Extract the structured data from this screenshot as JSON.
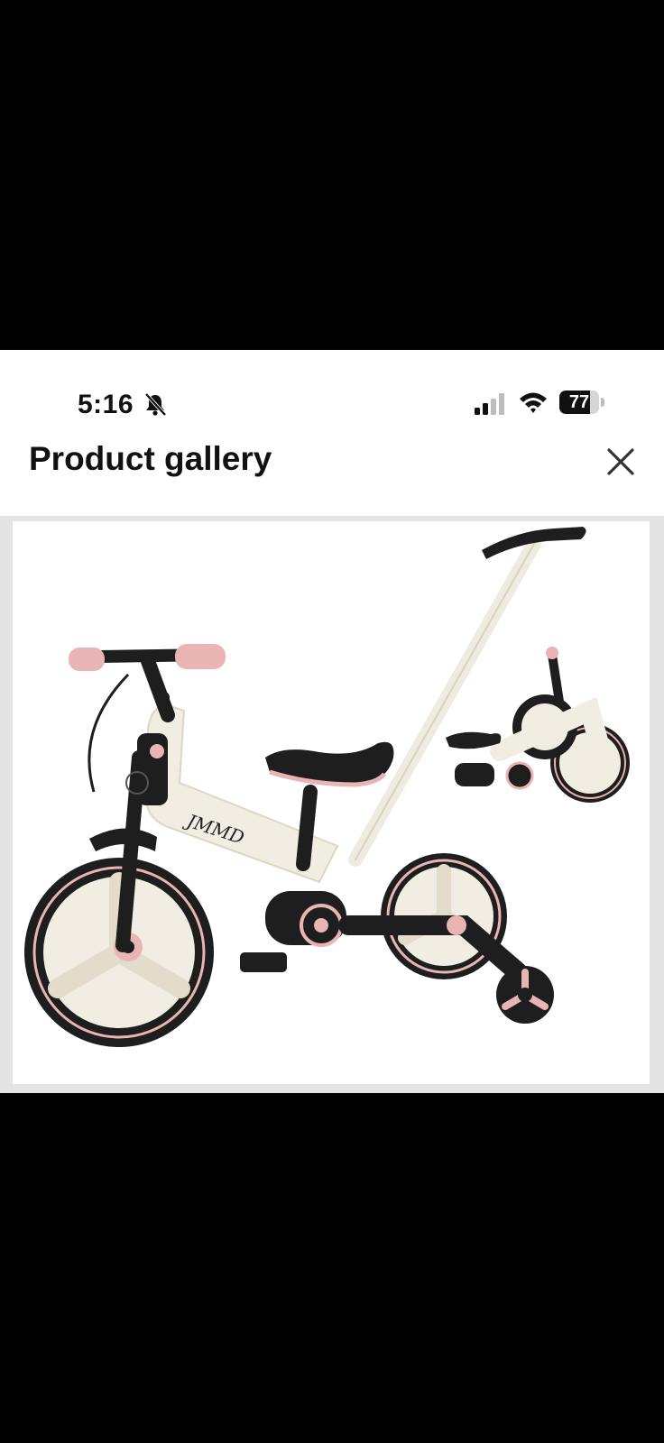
{
  "status_bar": {
    "time": "5:16",
    "battery_level": "77",
    "battery_fraction": 0.77,
    "icons": [
      "bell-slash-icon",
      "cellular-signal-icon",
      "wifi-icon",
      "battery-icon"
    ]
  },
  "header": {
    "title": "Product gallery",
    "close_icon": "close-icon"
  },
  "gallery": {
    "brand_mark": "JMMD",
    "colors": {
      "frame": "#f1ede3",
      "accent": "#e8b4b4",
      "dark": "#1e1e1e"
    }
  }
}
